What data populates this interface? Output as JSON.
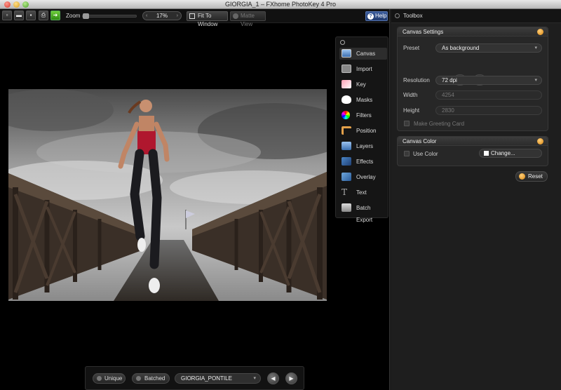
{
  "window": {
    "title": "GIORGIA_1 – FXhome PhotoKey 4 Pro"
  },
  "toolbar": {
    "zoom_label": "Zoom",
    "zoom_value": "17%",
    "zoom_left_icon": "minus-icon",
    "zoom_right_icon": "plus-icon",
    "fit_to_window": "Fit To Window",
    "matte_view": "Matte View",
    "help": "Help"
  },
  "tools_panel": {
    "items": [
      {
        "label": "Canvas",
        "icon": "canvas-icon",
        "active": true
      },
      {
        "label": "Import",
        "icon": "camera-icon"
      },
      {
        "label": "Key",
        "icon": "eraser-icon"
      },
      {
        "label": "Masks",
        "icon": "mask-icon"
      },
      {
        "label": "Filters",
        "icon": "color-wheel-icon"
      },
      {
        "label": "Position",
        "icon": "position-icon"
      },
      {
        "label": "Layers",
        "icon": "layers-icon"
      },
      {
        "label": "Effects",
        "icon": "wand-icon"
      },
      {
        "label": "Overlay",
        "icon": "overlay-icon"
      },
      {
        "label": "Text",
        "icon": "text-icon"
      },
      {
        "label": "Batch Export",
        "icon": "batch-export-icon"
      }
    ]
  },
  "toolbox": {
    "title": "Toolbox",
    "canvas_settings": {
      "title": "Canvas Settings",
      "preset_label": "Preset",
      "preset_value": "As background",
      "resolution_label": "Resolution",
      "resolution_value": "72 dpi",
      "width_label": "Width",
      "width_value": "4254",
      "height_label": "Height",
      "height_value": "2830",
      "greeting_card_label": "Make Greeting Card"
    },
    "canvas_color": {
      "title": "Canvas Color",
      "use_color_label": "Use Color",
      "change_label": "Change..."
    },
    "reset_label": "Reset"
  },
  "bottom_bar": {
    "unique_label": "Unique",
    "batched_label": "Batched",
    "image_name": "GIORGIA_PONTILE",
    "prev_icon": "previous-icon",
    "next_icon": "next-icon"
  },
  "colors": {
    "accent_orange": "#d9840e",
    "help_blue": "#2a4a8a",
    "go_green": "#4aa51c"
  }
}
